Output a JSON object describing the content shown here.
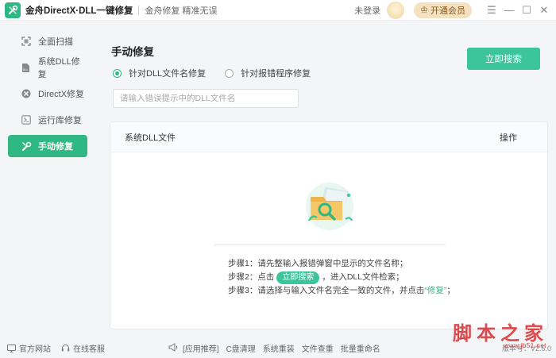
{
  "titlebar": {
    "app_title": "金舟DirectX·DLL一键修复",
    "subtitle": "金舟修复 精准无误",
    "login_text": "未登录",
    "vip_label": "开通会员",
    "min_glyph": "—",
    "max_glyph": "☐",
    "close_glyph": "✕",
    "menu_glyph": "☰"
  },
  "sidebar": {
    "items": [
      {
        "label": "全面扫描",
        "icon": "scan-icon",
        "active": false
      },
      {
        "label": "系统DLL修复",
        "icon": "dll-file-icon",
        "active": false
      },
      {
        "label": "DirectX修复",
        "icon": "directx-icon",
        "active": false
      },
      {
        "label": "运行库修复",
        "icon": "runtime-icon",
        "active": false
      },
      {
        "label": "手动修复",
        "icon": "wrench-icon",
        "active": true
      }
    ]
  },
  "main": {
    "title": "手动修复",
    "search_button": "立即搜索",
    "radio_options": [
      {
        "label": "针对DLL文件名修复",
        "selected": true
      },
      {
        "label": "针对报错程序修复",
        "selected": false
      }
    ],
    "input_placeholder": "请输入错误提示中的DLL文件名",
    "input_value": "",
    "table": {
      "col_file": "系统DLL文件",
      "col_action": "操作"
    },
    "steps": {
      "s1": "步骤1：请先整输入报错弹窗中显示的文件名称；",
      "s2_pre": "步骤2：点击",
      "s2_btn": "立即搜索",
      "s2_post": "，进入DLL文件检索；",
      "s3_pre": "步骤3：请选择与输入文件名完全一致的文件，并点击",
      "s3_hl": "“修复”",
      "s3_post": "；"
    }
  },
  "footer": {
    "website": "官方网站",
    "service": "在线客服",
    "tools": [
      "[应用推荐]",
      "C盘清理",
      "系统重装",
      "文件查重",
      "批量重命名"
    ],
    "version": "版本号：V2.5.0"
  },
  "watermark": {
    "text": "脚本之家",
    "url": "www.jb51.net"
  },
  "colors": {
    "accent": "#2fb884",
    "button": "#3cc49a",
    "vip": "#f3e1c0",
    "watermark": "#d9383b"
  }
}
